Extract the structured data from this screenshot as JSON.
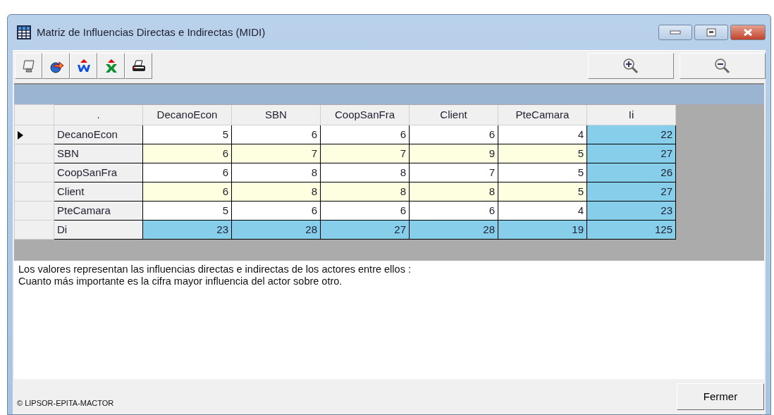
{
  "window": {
    "title": "Matriz de Influencias Directas e Indirectas (MIDI)"
  },
  "toolbar": {
    "buttons": [
      {
        "kind": "monitor"
      },
      {
        "kind": "export"
      },
      {
        "kind": "word"
      },
      {
        "kind": "excel"
      },
      {
        "kind": "print"
      }
    ],
    "zoom_buttons": [
      {
        "kind": "zoom-in"
      },
      {
        "kind": "zoom-out"
      }
    ]
  },
  "table": {
    "corner": ".",
    "columns": [
      "DecanoEcon",
      "SBN",
      "CoopSanFra",
      "Client",
      "PteCamara",
      "Ii"
    ],
    "rows": [
      {
        "label": "DecanoEcon",
        "kind": "actor",
        "selected": true,
        "highlighted": false,
        "cells": [
          "5",
          "6",
          "6",
          "6",
          "4",
          "22"
        ]
      },
      {
        "label": "SBN",
        "kind": "actor",
        "selected": false,
        "highlighted": true,
        "cells": [
          "6",
          "7",
          "7",
          "9",
          "5",
          "27"
        ]
      },
      {
        "label": "CoopSanFra",
        "kind": "actor",
        "selected": false,
        "highlighted": false,
        "cells": [
          "6",
          "8",
          "8",
          "7",
          "5",
          "26"
        ]
      },
      {
        "label": "Client",
        "kind": "actor",
        "selected": false,
        "highlighted": true,
        "cells": [
          "6",
          "8",
          "8",
          "8",
          "5",
          "27"
        ]
      },
      {
        "label": "PteCamara",
        "kind": "actor",
        "selected": false,
        "highlighted": false,
        "cells": [
          "5",
          "6",
          "6",
          "6",
          "4",
          "23"
        ]
      },
      {
        "label": "Di",
        "kind": "total",
        "selected": false,
        "highlighted": false,
        "cells": [
          "23",
          "28",
          "27",
          "28",
          "19",
          "125"
        ]
      }
    ]
  },
  "description": [
    "Los valores representan las influencias directas e indirectas de los actores entre ellos :",
    "Cuanto más importante es la cifra mayor influencia del actor sobre otro."
  ],
  "footer": {
    "copyright": "© LIPSOR-EPITA-MACTOR",
    "close_button": "Fermer"
  }
}
